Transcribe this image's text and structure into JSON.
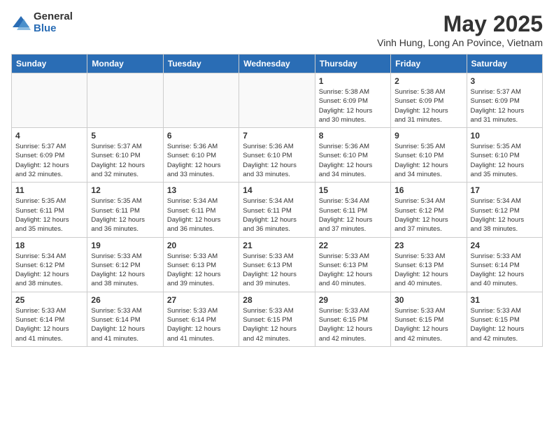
{
  "logo": {
    "general": "General",
    "blue": "Blue"
  },
  "title": "May 2025",
  "location": "Vinh Hung, Long An Povince, Vietnam",
  "weekdays": [
    "Sunday",
    "Monday",
    "Tuesday",
    "Wednesday",
    "Thursday",
    "Friday",
    "Saturday"
  ],
  "weeks": [
    [
      {
        "day": "",
        "info": ""
      },
      {
        "day": "",
        "info": ""
      },
      {
        "day": "",
        "info": ""
      },
      {
        "day": "",
        "info": ""
      },
      {
        "day": "1",
        "info": "Sunrise: 5:38 AM\nSunset: 6:09 PM\nDaylight: 12 hours\nand 30 minutes."
      },
      {
        "day": "2",
        "info": "Sunrise: 5:38 AM\nSunset: 6:09 PM\nDaylight: 12 hours\nand 31 minutes."
      },
      {
        "day": "3",
        "info": "Sunrise: 5:37 AM\nSunset: 6:09 PM\nDaylight: 12 hours\nand 31 minutes."
      }
    ],
    [
      {
        "day": "4",
        "info": "Sunrise: 5:37 AM\nSunset: 6:09 PM\nDaylight: 12 hours\nand 32 minutes."
      },
      {
        "day": "5",
        "info": "Sunrise: 5:37 AM\nSunset: 6:10 PM\nDaylight: 12 hours\nand 32 minutes."
      },
      {
        "day": "6",
        "info": "Sunrise: 5:36 AM\nSunset: 6:10 PM\nDaylight: 12 hours\nand 33 minutes."
      },
      {
        "day": "7",
        "info": "Sunrise: 5:36 AM\nSunset: 6:10 PM\nDaylight: 12 hours\nand 33 minutes."
      },
      {
        "day": "8",
        "info": "Sunrise: 5:36 AM\nSunset: 6:10 PM\nDaylight: 12 hours\nand 34 minutes."
      },
      {
        "day": "9",
        "info": "Sunrise: 5:35 AM\nSunset: 6:10 PM\nDaylight: 12 hours\nand 34 minutes."
      },
      {
        "day": "10",
        "info": "Sunrise: 5:35 AM\nSunset: 6:10 PM\nDaylight: 12 hours\nand 35 minutes."
      }
    ],
    [
      {
        "day": "11",
        "info": "Sunrise: 5:35 AM\nSunset: 6:11 PM\nDaylight: 12 hours\nand 35 minutes."
      },
      {
        "day": "12",
        "info": "Sunrise: 5:35 AM\nSunset: 6:11 PM\nDaylight: 12 hours\nand 36 minutes."
      },
      {
        "day": "13",
        "info": "Sunrise: 5:34 AM\nSunset: 6:11 PM\nDaylight: 12 hours\nand 36 minutes."
      },
      {
        "day": "14",
        "info": "Sunrise: 5:34 AM\nSunset: 6:11 PM\nDaylight: 12 hours\nand 36 minutes."
      },
      {
        "day": "15",
        "info": "Sunrise: 5:34 AM\nSunset: 6:11 PM\nDaylight: 12 hours\nand 37 minutes."
      },
      {
        "day": "16",
        "info": "Sunrise: 5:34 AM\nSunset: 6:12 PM\nDaylight: 12 hours\nand 37 minutes."
      },
      {
        "day": "17",
        "info": "Sunrise: 5:34 AM\nSunset: 6:12 PM\nDaylight: 12 hours\nand 38 minutes."
      }
    ],
    [
      {
        "day": "18",
        "info": "Sunrise: 5:34 AM\nSunset: 6:12 PM\nDaylight: 12 hours\nand 38 minutes."
      },
      {
        "day": "19",
        "info": "Sunrise: 5:33 AM\nSunset: 6:12 PM\nDaylight: 12 hours\nand 38 minutes."
      },
      {
        "day": "20",
        "info": "Sunrise: 5:33 AM\nSunset: 6:13 PM\nDaylight: 12 hours\nand 39 minutes."
      },
      {
        "day": "21",
        "info": "Sunrise: 5:33 AM\nSunset: 6:13 PM\nDaylight: 12 hours\nand 39 minutes."
      },
      {
        "day": "22",
        "info": "Sunrise: 5:33 AM\nSunset: 6:13 PM\nDaylight: 12 hours\nand 40 minutes."
      },
      {
        "day": "23",
        "info": "Sunrise: 5:33 AM\nSunset: 6:13 PM\nDaylight: 12 hours\nand 40 minutes."
      },
      {
        "day": "24",
        "info": "Sunrise: 5:33 AM\nSunset: 6:14 PM\nDaylight: 12 hours\nand 40 minutes."
      }
    ],
    [
      {
        "day": "25",
        "info": "Sunrise: 5:33 AM\nSunset: 6:14 PM\nDaylight: 12 hours\nand 41 minutes."
      },
      {
        "day": "26",
        "info": "Sunrise: 5:33 AM\nSunset: 6:14 PM\nDaylight: 12 hours\nand 41 minutes."
      },
      {
        "day": "27",
        "info": "Sunrise: 5:33 AM\nSunset: 6:14 PM\nDaylight: 12 hours\nand 41 minutes."
      },
      {
        "day": "28",
        "info": "Sunrise: 5:33 AM\nSunset: 6:15 PM\nDaylight: 12 hours\nand 42 minutes."
      },
      {
        "day": "29",
        "info": "Sunrise: 5:33 AM\nSunset: 6:15 PM\nDaylight: 12 hours\nand 42 minutes."
      },
      {
        "day": "30",
        "info": "Sunrise: 5:33 AM\nSunset: 6:15 PM\nDaylight: 12 hours\nand 42 minutes."
      },
      {
        "day": "31",
        "info": "Sunrise: 5:33 AM\nSunset: 6:15 PM\nDaylight: 12 hours\nand 42 minutes."
      }
    ]
  ]
}
